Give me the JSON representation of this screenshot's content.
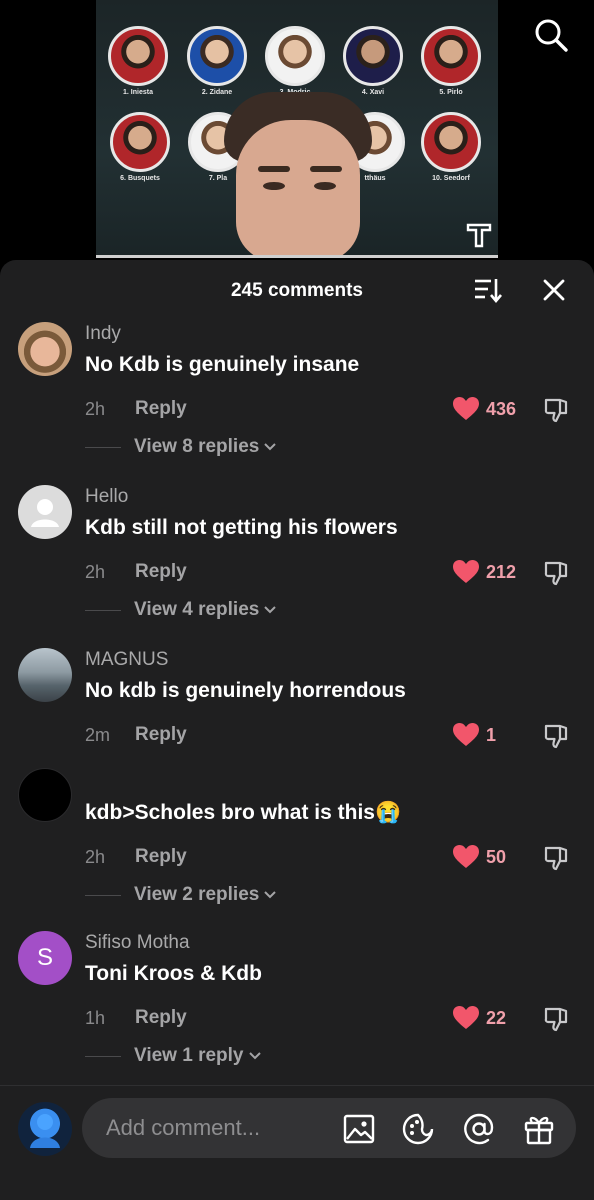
{
  "video": {
    "players": [
      {
        "label": "1. Iniesta"
      },
      {
        "label": "2. Zidane"
      },
      {
        "label": "3. Modric"
      },
      {
        "label": "4. Xavi"
      },
      {
        "label": "5. Pirlo"
      },
      {
        "label": "6. Busquets"
      },
      {
        "label": "7. Pla"
      },
      {
        "label": "tthäus"
      },
      {
        "label": "10. Seedorf"
      }
    ]
  },
  "sheet": {
    "title": "245 comments"
  },
  "comments": [
    {
      "user": "Indy",
      "text": "No Kdb is genuinely insane",
      "time": "2h",
      "reply": "Reply",
      "likes": "436",
      "view_replies": "View 8 replies"
    },
    {
      "user": "Hello",
      "text": "Kdb still not getting his flowers",
      "time": "2h",
      "reply": "Reply",
      "likes": "212",
      "view_replies": "View 4 replies"
    },
    {
      "user": "MAGNUS",
      "text": "No kdb is genuinely horrendous",
      "time": "2m",
      "reply": "Reply",
      "likes": "1"
    },
    {
      "user": "",
      "text": "kdb>Scholes bro what is this😭",
      "time": "2h",
      "reply": "Reply",
      "likes": "50",
      "view_replies": "View 2 replies"
    },
    {
      "user": "Sifiso Motha",
      "avatar_letter": "S",
      "text": "Toni Kroos & Kdb",
      "time": "1h",
      "reply": "Reply",
      "likes": "22",
      "view_replies": "View 1 reply"
    }
  ],
  "input": {
    "placeholder": "Add comment..."
  },
  "colors": {
    "sheet_bg": "#1f1f20",
    "like_heart": "#f2566b",
    "avatar_s": "#a34fc7"
  }
}
